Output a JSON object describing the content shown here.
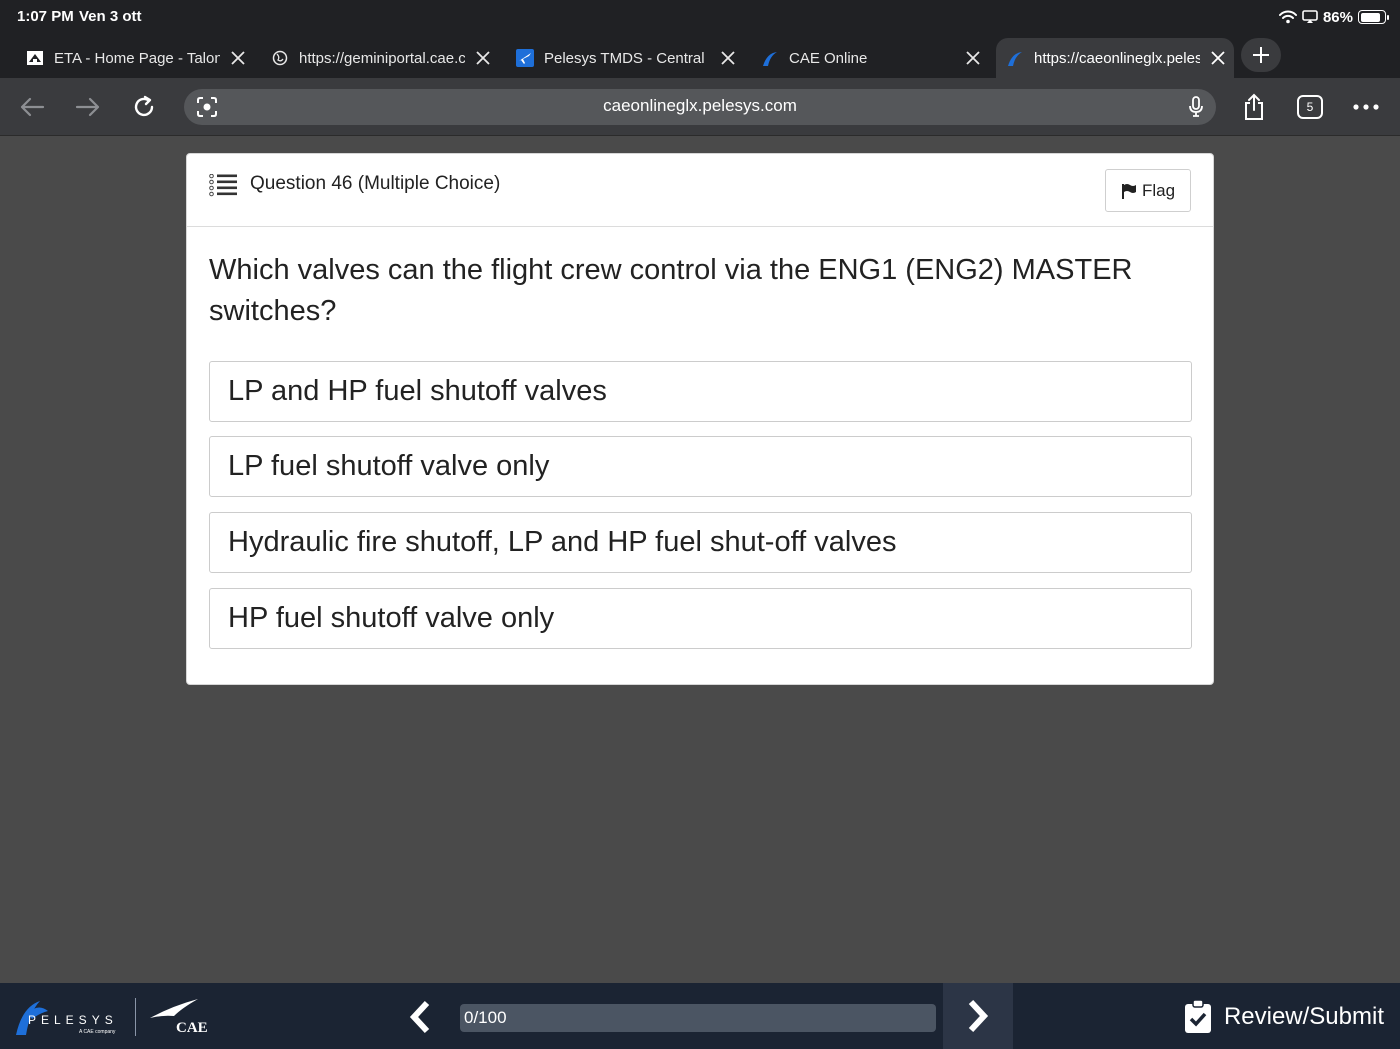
{
  "status": {
    "time": "1:07 PM",
    "date": "Ven 3 ott",
    "battery": "86%",
    "battery_level": 0.86
  },
  "tabs": [
    {
      "title": "ETA - Home Page - Talon",
      "icon": "house-icon",
      "active": false
    },
    {
      "title": "https://geminiportal.cae.com",
      "icon": "globe-icon",
      "active": false
    },
    {
      "title": "Pelesys TMDS - Central",
      "icon": "plane-icon",
      "active": false
    },
    {
      "title": "CAE Online",
      "icon": "pelesys-icon",
      "active": false
    },
    {
      "title": "https://caeonlineglx.pelesys.com",
      "icon": "pelesys-icon",
      "active": true
    }
  ],
  "toolbar": {
    "url": "caeonlineglx.pelesys.com",
    "tab_count": "5"
  },
  "question": {
    "title": "Question 46 (Multiple Choice)",
    "flag_label": "Flag",
    "text": "Which valves can the flight crew control via the ENG1 (ENG2) MASTER switches?",
    "options": [
      "LP and HP fuel shutoff valves",
      "LP fuel shutoff valve only",
      "Hydraulic fire shutoff, LP and HP fuel shut-off valves",
      "HP fuel shutoff valve only"
    ]
  },
  "footer": {
    "progress_text": "0/100",
    "progress_value": 0,
    "review_label": "Review/Submit"
  },
  "colors": {
    "accent": "#2d7fd0",
    "footer_bg": "#1b2433",
    "page_bg": "#4a4a4a"
  }
}
